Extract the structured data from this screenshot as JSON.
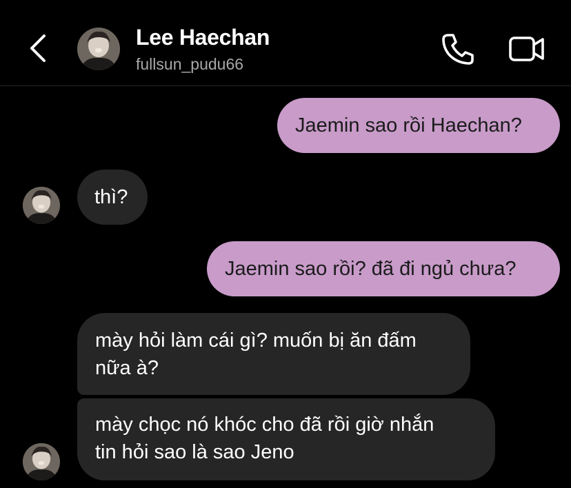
{
  "header": {
    "back_icon": "chevron-left-icon",
    "name": "Lee Haechan",
    "username": "fullsun_pudu66",
    "call_icon": "phone-icon",
    "video_icon": "video-camera-icon"
  },
  "messages": [
    {
      "direction": "sent",
      "text": "Jaemin sao rồi Haechan?"
    },
    {
      "direction": "received",
      "text": "thì?"
    },
    {
      "direction": "sent",
      "text": "Jaemin sao rồi? đã đi ngủ chưa?"
    },
    {
      "direction": "received",
      "lines": [
        "mày hỏi làm cái gì? muốn bị ăn đấm",
        "nữa à?"
      ]
    },
    {
      "direction": "received",
      "lines": [
        "mày chọc nó khóc cho đã rồi giờ nhắn",
        "tin hỏi sao là sao Jeno"
      ]
    }
  ],
  "colors": {
    "background": "#000000",
    "sent_bubble": "#c89bc9",
    "received_bubble": "#262626",
    "secondary_text": "#a8a8a8"
  }
}
